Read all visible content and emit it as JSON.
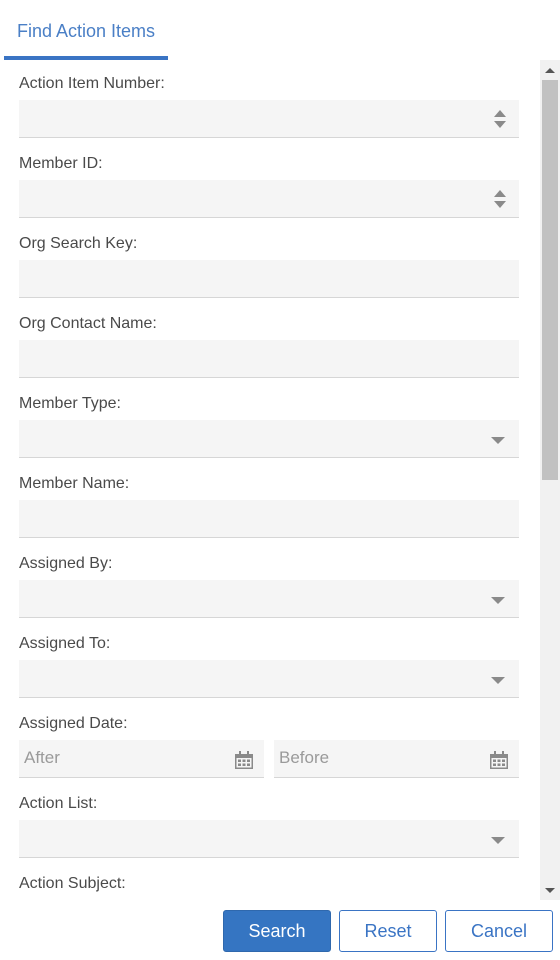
{
  "tabs": [
    {
      "label": "Find Action Items",
      "active": true
    }
  ],
  "form": {
    "action_item_number": {
      "label": "Action Item Number:",
      "value": ""
    },
    "member_id": {
      "label": "Member ID:",
      "value": ""
    },
    "org_search_key": {
      "label": "Org Search Key:",
      "value": ""
    },
    "org_contact_name": {
      "label": "Org Contact Name:",
      "value": ""
    },
    "member_type": {
      "label": "Member Type:",
      "selected": ""
    },
    "member_name": {
      "label": "Member Name:",
      "value": ""
    },
    "assigned_by": {
      "label": "Assigned By:",
      "selected": ""
    },
    "assigned_to": {
      "label": "Assigned To:",
      "selected": ""
    },
    "assigned_date": {
      "label": "Assigned Date:",
      "after_placeholder": "After",
      "before_placeholder": "Before"
    },
    "action_list": {
      "label": "Action List:",
      "selected": ""
    },
    "action_subject": {
      "label": "Action Subject:"
    }
  },
  "buttons": {
    "search": "Search",
    "reset": "Reset",
    "cancel": "Cancel"
  },
  "colors": {
    "accent": "#3a74c4",
    "primary_button": "#3575c2",
    "field_bg": "#f5f5f5"
  },
  "icons": [
    "spinner-icon",
    "dropdown-caret-icon",
    "calendar-icon"
  ]
}
